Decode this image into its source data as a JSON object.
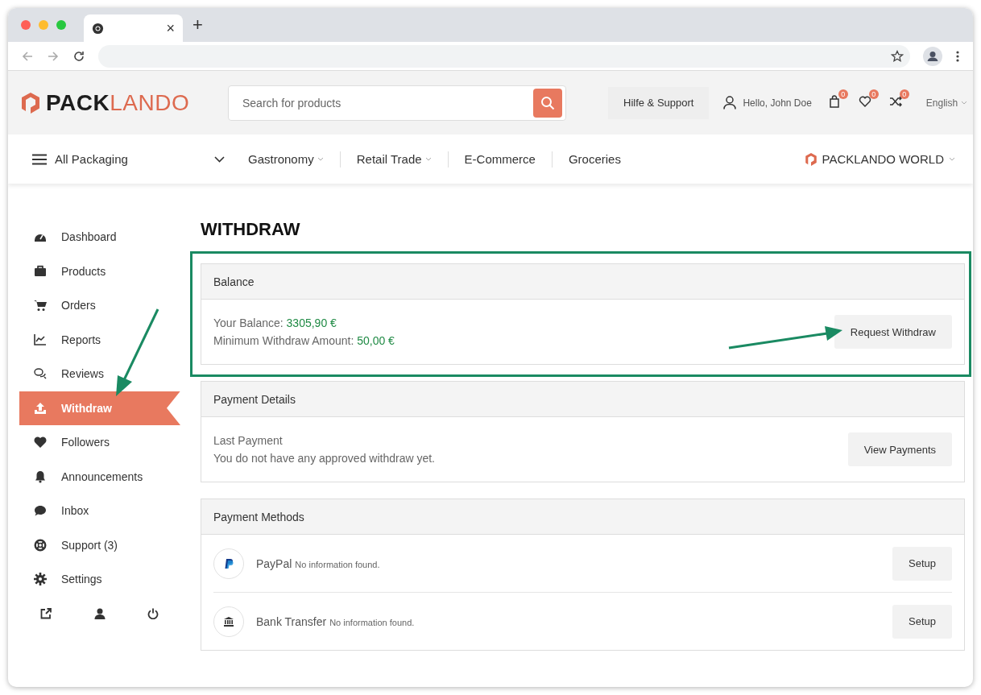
{
  "browser": {
    "tab_close": "×",
    "new_tab": "+"
  },
  "header": {
    "logo": {
      "dark": "PACK",
      "accent": "LANDO"
    },
    "search": {
      "placeholder": "Search for products"
    },
    "help_button": "Hilfe & Support",
    "greeting": "Hello, John Doe",
    "counters": [
      {
        "count": "0"
      },
      {
        "count": "0"
      },
      {
        "count": "0"
      }
    ],
    "language": "English"
  },
  "nav": {
    "all_label": "All Packaging",
    "items": [
      {
        "label": "Gastronomy",
        "has_dropdown": true
      },
      {
        "label": "Retail Trade",
        "has_dropdown": true
      },
      {
        "label": "E-Commerce",
        "has_dropdown": false
      },
      {
        "label": "Groceries",
        "has_dropdown": false
      }
    ],
    "world": "PACKLANDO WORLD"
  },
  "sidebar": {
    "items": [
      {
        "label": "Dashboard",
        "selected": false
      },
      {
        "label": "Products",
        "selected": false
      },
      {
        "label": "Orders",
        "selected": false
      },
      {
        "label": "Reports",
        "selected": false
      },
      {
        "label": "Reviews",
        "selected": false
      },
      {
        "label": "Withdraw",
        "selected": true
      },
      {
        "label": "Followers",
        "selected": false
      },
      {
        "label": "Announcements",
        "selected": false
      },
      {
        "label": "Inbox",
        "selected": false
      },
      {
        "label": "Support (3)",
        "selected": false
      },
      {
        "label": "Settings",
        "selected": false
      }
    ]
  },
  "page": {
    "title": "WITHDRAW",
    "balance": {
      "header": "Balance",
      "lines": [
        {
          "label": "Your Balance:",
          "value": "3305,90 €"
        },
        {
          "label": "Minimum Withdraw Amount:",
          "value": "50,00 €"
        }
      ],
      "button": "Request Withdraw"
    },
    "payment_details": {
      "header": "Payment Details",
      "title": "Last Payment",
      "text": "You do not have any approved withdraw yet.",
      "button": "View Payments"
    },
    "payment_methods": {
      "header": "Payment Methods",
      "methods": [
        {
          "name": "PayPal",
          "status": "No information found.",
          "button": "Setup"
        },
        {
          "name": "Bank Transfer",
          "status": "No information found.",
          "button": "Setup"
        }
      ]
    }
  }
}
